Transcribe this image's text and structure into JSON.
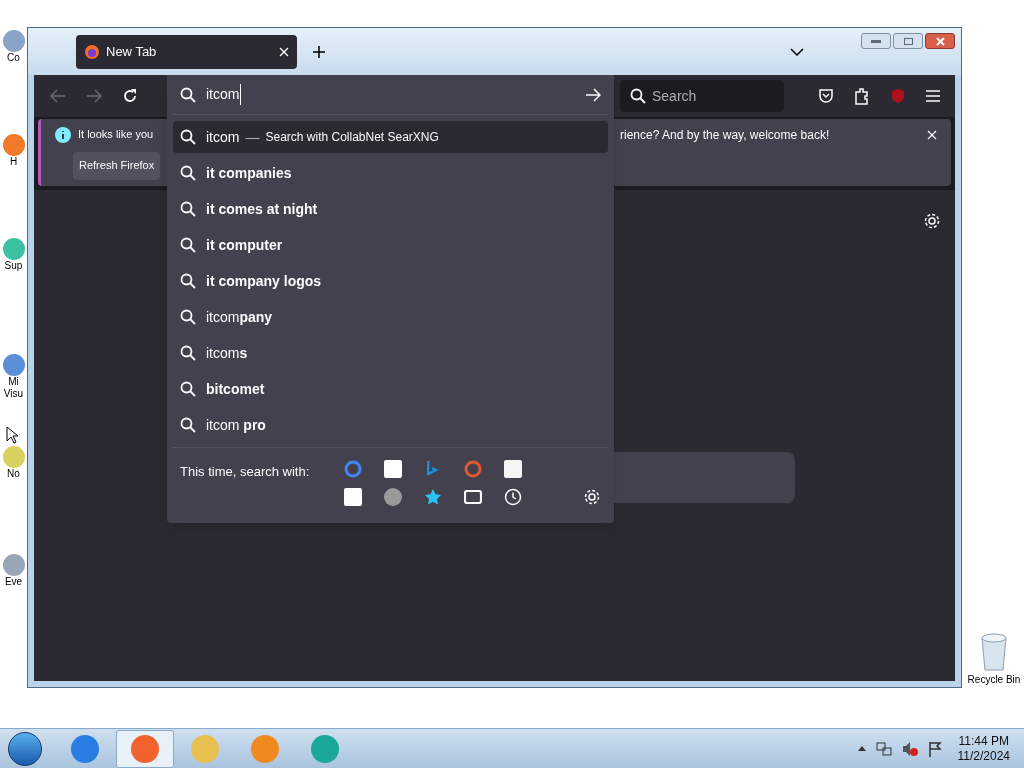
{
  "desktop_icons": [
    {
      "label": "Co",
      "color": "#8aa4c8"
    },
    {
      "label": "H",
      "color": "#f07a2a"
    },
    {
      "label": "Sup",
      "color": "#3cc2a0"
    },
    {
      "label": "Mi Visu",
      "color": "#5a8fd8"
    },
    {
      "label": "No",
      "color": "#d8d060"
    },
    {
      "label": "Eve",
      "color": "#9aa6b8"
    }
  ],
  "recycle_bin": {
    "label": "Recycle Bin"
  },
  "browser": {
    "tab": {
      "title": "New Tab",
      "selected": true
    },
    "toolbar": {
      "back_disabled": true,
      "forward_disabled": true,
      "search_placeholder": "Search"
    },
    "notification": {
      "text_start": "It looks like you",
      "text_end": "rience? And by the way, welcome back!",
      "button": "Refresh Firefox"
    },
    "urlbar": {
      "value": "itcom"
    },
    "suggestions": [
      {
        "prefix": "itcom",
        "separator": "—",
        "action": "Search with CollabNet SearXNG",
        "selected": true
      },
      {
        "suffix": "it companies",
        "selected": false
      },
      {
        "suffix": "it comes at night",
        "selected": false
      },
      {
        "suffix": "it computer",
        "selected": false
      },
      {
        "suffix": "it company logos",
        "selected": false
      },
      {
        "prefix": "itcom",
        "suffix": "pany",
        "selected": false
      },
      {
        "prefix": "itcom",
        "suffix": "s",
        "selected": false
      },
      {
        "suffix": "bitcomet",
        "selected": false
      },
      {
        "prefix": "itcom ",
        "suffix": "pro",
        "selected": false
      }
    ],
    "search_with": {
      "label": "This time, search with:",
      "engines": [
        {
          "kind": "ring",
          "color": "#4285f4"
        },
        {
          "kind": "tile",
          "color": "#ffffff"
        },
        {
          "kind": "mark",
          "color": "#1a8fe0"
        },
        {
          "kind": "ring",
          "color": "#de5833"
        },
        {
          "kind": "tile",
          "color": "#f5f5f5"
        },
        {
          "kind": "tile",
          "color": "#ffffff"
        },
        {
          "kind": "disc",
          "color": "#9a9a9a"
        },
        {
          "kind": "star",
          "color": "#2ac3f0"
        },
        {
          "kind": "tabs",
          "color": "#fbfbfe"
        },
        {
          "kind": "clock",
          "color": "#fbfbfe"
        }
      ]
    }
  },
  "taskbar": {
    "apps": [
      {
        "color": "#2a7de0",
        "selected": false
      },
      {
        "color": "#f2622e",
        "selected": true
      },
      {
        "color": "#e8c050",
        "selected": false
      },
      {
        "color": "#f08a20",
        "selected": false
      },
      {
        "color": "#1aa89a",
        "selected": false
      }
    ],
    "time": "11:44 PM",
    "date": "11/2/2024"
  }
}
